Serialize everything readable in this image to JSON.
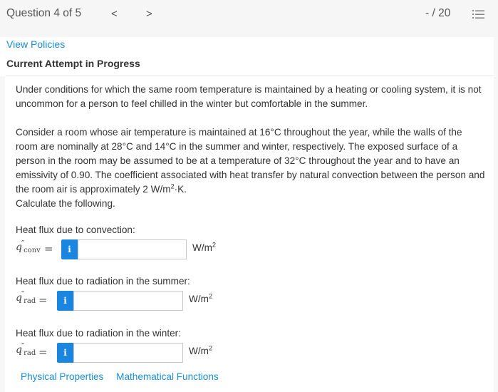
{
  "header": {
    "question_title": "Question 4 of 5",
    "prev_label": "<",
    "next_label": ">",
    "score": "- / 20",
    "list_icon": "numbered-list-icon"
  },
  "meta": {
    "view_policies": "View Policies",
    "attempt_status": "Current Attempt in Progress"
  },
  "problem": {
    "paragraph1": "Under conditions for which the same room temperature is maintained by a heating or cooling system, it is not uncommon for a person to feel chilled in the winter but comfortable in the summer.",
    "paragraph2_a": "Consider a room whose air temperature is maintained at 16°C throughout the year, while the walls of the room are nominally at 28°C and 14°C in the summer and winter, respectively. The exposed surface of a person in the room may be assumed to be at a temperature of 32°C throughout the year and to have an emissivity of 0.90. The coefficient associated with heat transfer by natural convection between the person and the room air is approximately 2 W/m",
    "paragraph2_sup": "2",
    "paragraph2_b": "·K.",
    "instruction": "Calculate the following."
  },
  "questions": [
    {
      "label": "Heat flux due to convection:",
      "symbol": "q",
      "subscript": "conv",
      "equals": "=",
      "info": "i",
      "value": "",
      "unit": "W/m",
      "unit_sup": "2"
    },
    {
      "label": "Heat flux due to radiation in the summer:",
      "symbol": "q",
      "subscript": "rad",
      "equals": "=",
      "info": "i",
      "value": "",
      "unit": "W/m",
      "unit_sup": "2"
    },
    {
      "label": "Heat flux due to radiation in the winter:",
      "symbol": "q",
      "subscript": "rad",
      "equals": "=",
      "info": "i",
      "value": "",
      "unit": "W/m",
      "unit_sup": "2"
    }
  ],
  "footer_links": {
    "physical_properties": "Physical Properties",
    "mathematical_functions": "Mathematical Functions"
  },
  "colors": {
    "link": "#1a8ed6",
    "info_button": "#1a86e0"
  }
}
